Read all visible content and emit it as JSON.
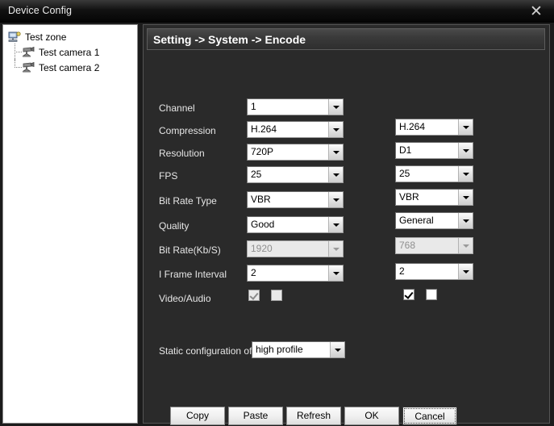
{
  "window": {
    "title": "Device Config",
    "close_icon": "close-icon"
  },
  "tree": {
    "root": {
      "label": "Test zone",
      "icon": "zone-icon"
    },
    "children": [
      {
        "label": "Test camera 1",
        "icon": "camera-icon"
      },
      {
        "label": "Test camera 2",
        "icon": "camera-icon"
      }
    ]
  },
  "panel": {
    "header": "Setting -> System -> Encode"
  },
  "form": {
    "rows": [
      {
        "label": "Channel",
        "main": "1",
        "sub": null,
        "type": "combo"
      },
      {
        "label": "Compression",
        "main": "H.264",
        "sub": "H.264",
        "type": "combo"
      },
      {
        "label": "Resolution",
        "main": "720P",
        "sub": "D1",
        "type": "combo"
      },
      {
        "label": "FPS",
        "main": "25",
        "sub": "25",
        "type": "combo"
      },
      {
        "label": "Bit Rate Type",
        "main": "VBR",
        "sub": "VBR",
        "type": "combo"
      },
      {
        "label": "Quality",
        "main": "Good",
        "sub": "General",
        "type": "combo"
      },
      {
        "label": "Bit Rate(Kb/S)",
        "main": "1920",
        "sub": "768",
        "type": "combo-disabled"
      },
      {
        "label": "I Frame Interval",
        "main": "2",
        "sub": "2",
        "type": "combo"
      },
      {
        "label": "Video/Audio",
        "main": null,
        "sub": null,
        "type": "checkboxes"
      }
    ],
    "static_config": {
      "label": "Static configuration of",
      "value": "high profile"
    },
    "checkboxes": {
      "main_video_checked": true,
      "main_audio_checked": false,
      "sub_video_checked": true,
      "sub_audio_checked": false
    }
  },
  "buttons": [
    {
      "label": "Copy",
      "focused": false
    },
    {
      "label": "Paste",
      "focused": false
    },
    {
      "label": "Refresh",
      "focused": false
    },
    {
      "label": "OK",
      "focused": false
    },
    {
      "label": "Cancel",
      "focused": true
    }
  ],
  "colors": {
    "window_bg": "#1c1c1c",
    "panel_bg": "#2a2a2a",
    "tree_bg": "#ffffff",
    "label_text": "#e6e6e6",
    "header_text": "#ffffff"
  }
}
